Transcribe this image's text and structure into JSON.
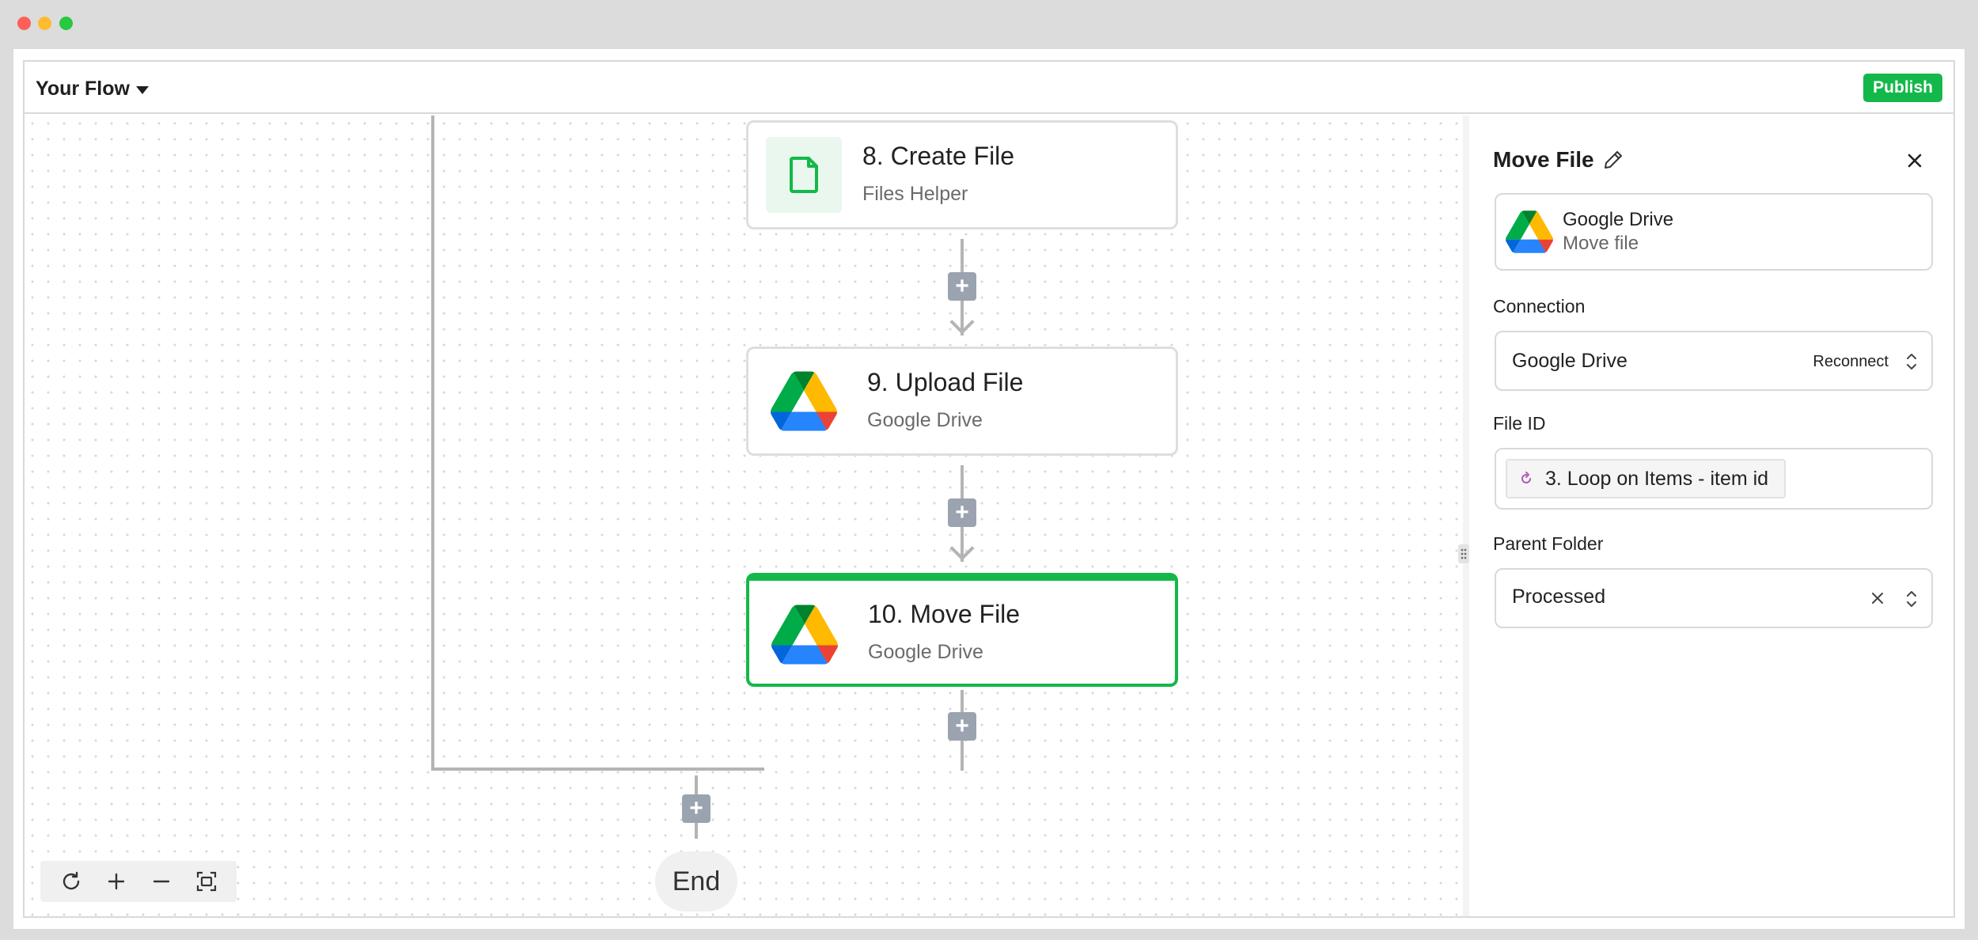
{
  "window": {
    "controls": [
      "close",
      "minimize",
      "maximize"
    ]
  },
  "header": {
    "flow_name": "Your Flow",
    "publish_label": "Publish"
  },
  "canvas": {
    "steps": [
      {
        "title": "8. Create File",
        "subtitle": "Files Helper",
        "icon": "file-icon"
      },
      {
        "title": "9. Upload File",
        "subtitle": "Google Drive",
        "icon": "google-drive-icon"
      },
      {
        "title": "10. Move File",
        "subtitle": "Google Drive",
        "icon": "google-drive-icon",
        "selected": true
      }
    ],
    "end_label": "End",
    "zoom_controls": [
      "reset-icon",
      "zoom-in-icon",
      "zoom-out-icon",
      "fit-view-icon"
    ]
  },
  "panel": {
    "title": "Move File",
    "piece": {
      "name": "Google Drive",
      "action": "Move file"
    },
    "connection": {
      "label": "Connection",
      "value": "Google Drive",
      "reconnect_label": "Reconnect"
    },
    "file_id": {
      "label": "File ID",
      "chip": "3. Loop on Items - item id"
    },
    "parent_folder": {
      "label": "Parent Folder",
      "value": "Processed"
    }
  },
  "colors": {
    "accent": "#14b84a",
    "plus_button": "#9aa3af",
    "edge": "#b4b4b4"
  }
}
